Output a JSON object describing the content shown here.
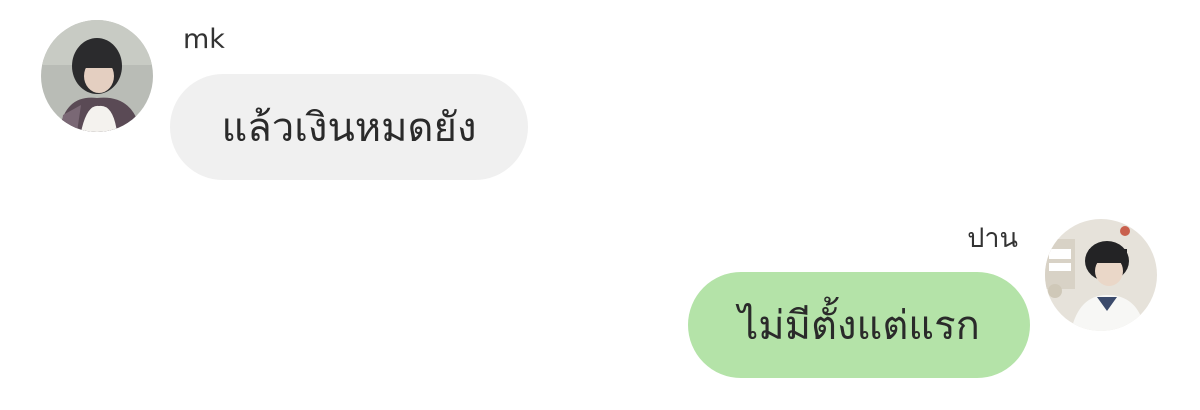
{
  "chat": {
    "messages": [
      {
        "sender": "mk",
        "text": "แล้วเงินหมดยัง",
        "side": "left",
        "bubble_color": "#f0f0f0"
      },
      {
        "sender": "ปาน",
        "text": "ไม่มีตั้งแต่แรก",
        "side": "right",
        "bubble_color": "#b4e3a8"
      }
    ],
    "avatar_icons": [
      "profile-photo-mk",
      "profile-photo-paan"
    ]
  }
}
